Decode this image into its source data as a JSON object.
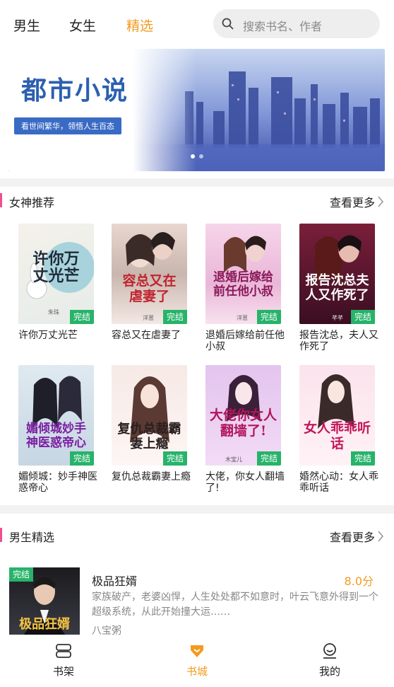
{
  "tabs": [
    {
      "label": "男生",
      "active": false
    },
    {
      "label": "女生",
      "active": false
    },
    {
      "label": "精选",
      "active": true
    }
  ],
  "search": {
    "placeholder": "搜索书名、作者",
    "icon": "search-icon"
  },
  "banner": {
    "title": "都市小说",
    "tagline": "看世间繁华，领悟人生百态",
    "dots": 2,
    "active_dot": 0
  },
  "section_female": {
    "title": "女神推荐",
    "more": "查看更多",
    "books": [
      {
        "name": "许你万丈光芒",
        "cover_text": "许你万丈光芒",
        "badge": "完结",
        "author_mark": "朱珠"
      },
      {
        "name": "容总又在虐妻了",
        "cover_text": "容总又在虐妻了",
        "badge": "完结",
        "author_mark": "洋葱"
      },
      {
        "name": "退婚后嫁给前任他小叔",
        "cover_text": "退婚后嫁给前任他小叔",
        "badge": "完结",
        "author_mark": "洋葱"
      },
      {
        "name": "报告沈总，夫人又作死了",
        "cover_text": "报告沈总夫人又作死了",
        "badge": "完结",
        "author_mark": "芊芊"
      },
      {
        "name": "媚倾城：妙手神医惑帝心",
        "cover_text": "媚倾城妙手神医惑帝心",
        "badge": "完结",
        "author_mark": ""
      },
      {
        "name": "复仇总裁霸妻上瘾",
        "cover_text": "复仇总裁霸妻上瘾",
        "badge": "完结",
        "author_mark": ""
      },
      {
        "name": "大佬，你女人翻墙了!",
        "cover_text": "大佬你女人翻墙了!",
        "badge": "完结",
        "author_mark": "木宝儿"
      },
      {
        "name": "婚然心动：女人乖乖听话",
        "cover_text": "女人乖乖听话",
        "badge": "完结",
        "author_mark": ""
      }
    ]
  },
  "section_male": {
    "title": "男生精选",
    "more": "查看更多",
    "book": {
      "name": "极品狂婿",
      "score": "8.0分",
      "badge": "完结",
      "cover_text": "极品狂婿",
      "description": "家族破产，老婆凶悍，人生处处都不如意时，叶云飞意外得到一个超级系统，从此开始撞大运……",
      "author": "八宝粥"
    }
  },
  "bottom_nav": [
    {
      "label": "书架",
      "icon": "bookshelf-icon",
      "active": false
    },
    {
      "label": "书城",
      "icon": "bookstore-icon",
      "active": true
    },
    {
      "label": "我的",
      "icon": "profile-icon",
      "active": false
    }
  ],
  "colors": {
    "accent": "#f39a1e",
    "section_bar": "#f34c8f",
    "badge": "#27b36a"
  }
}
